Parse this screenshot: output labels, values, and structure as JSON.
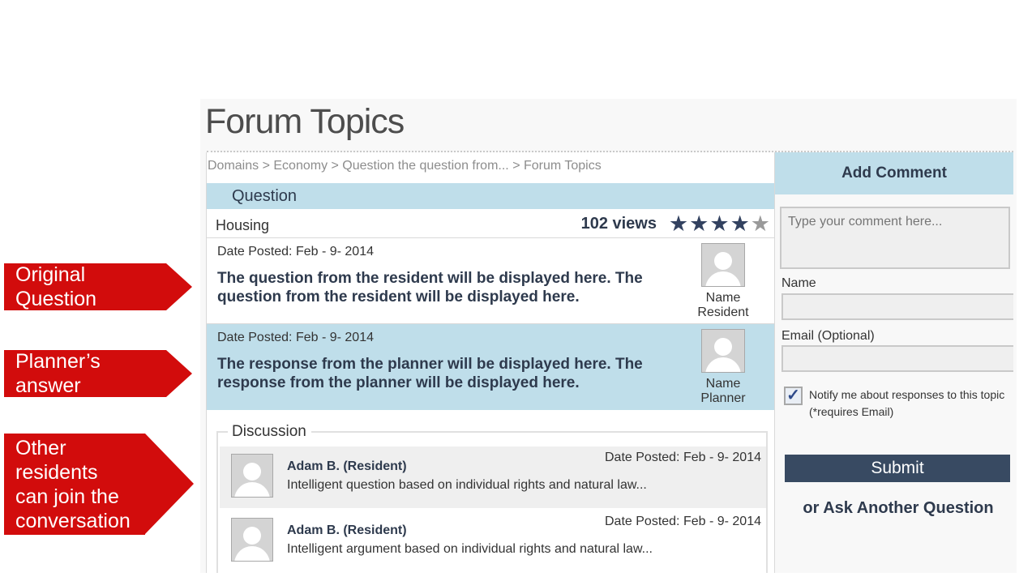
{
  "callouts": {
    "original": "Original Question",
    "planner": "Planner’s answer",
    "others": "Other residents\ncan join the\nconversation"
  },
  "page": {
    "title": "Forum Topics",
    "breadcrumb": "Domains > Economy > Question the question from... > Forum Topics"
  },
  "question": {
    "header": "Question",
    "topic": "Housing",
    "views": "102 views",
    "rating": 4,
    "rating_max": 5
  },
  "resident_post": {
    "date": "Date Posted: Feb - 9- 2014",
    "body": "The question from the resident will be displayed here. The question from the resident will be displayed here.",
    "name": "Name",
    "role": "Resident"
  },
  "planner_post": {
    "date": "Date Posted: Feb - 9- 2014",
    "body": "The response from the planner will be displayed here. The response from the planner will be displayed here.",
    "name": "Name",
    "role": "Planner"
  },
  "discussion": {
    "label": "Discussion",
    "items": [
      {
        "author": "Adam B. (Resident)",
        "text": "Intelligent question based on individual rights and natural law...",
        "date": "Date Posted: Feb - 9- 2014"
      },
      {
        "author": "Adam B. (Resident)",
        "text": "Intelligent argument based on individual rights and natural law...",
        "date": "Date Posted: Feb - 9- 2014"
      }
    ]
  },
  "comment_form": {
    "header": "Add Comment",
    "placeholder": "Type your comment here...",
    "name_label": "Name",
    "email_label": "Email (Optional)",
    "notify_label": "Notify me about responses to this topic",
    "notify_note": "(*requires Email)",
    "notify_checked": true,
    "submit_label": "Submit",
    "ask_link": "or Ask Another Question"
  },
  "colors": {
    "accent_light": "#bfdeea",
    "accent_dark": "#384a62",
    "callout_red": "#d20c0c"
  }
}
